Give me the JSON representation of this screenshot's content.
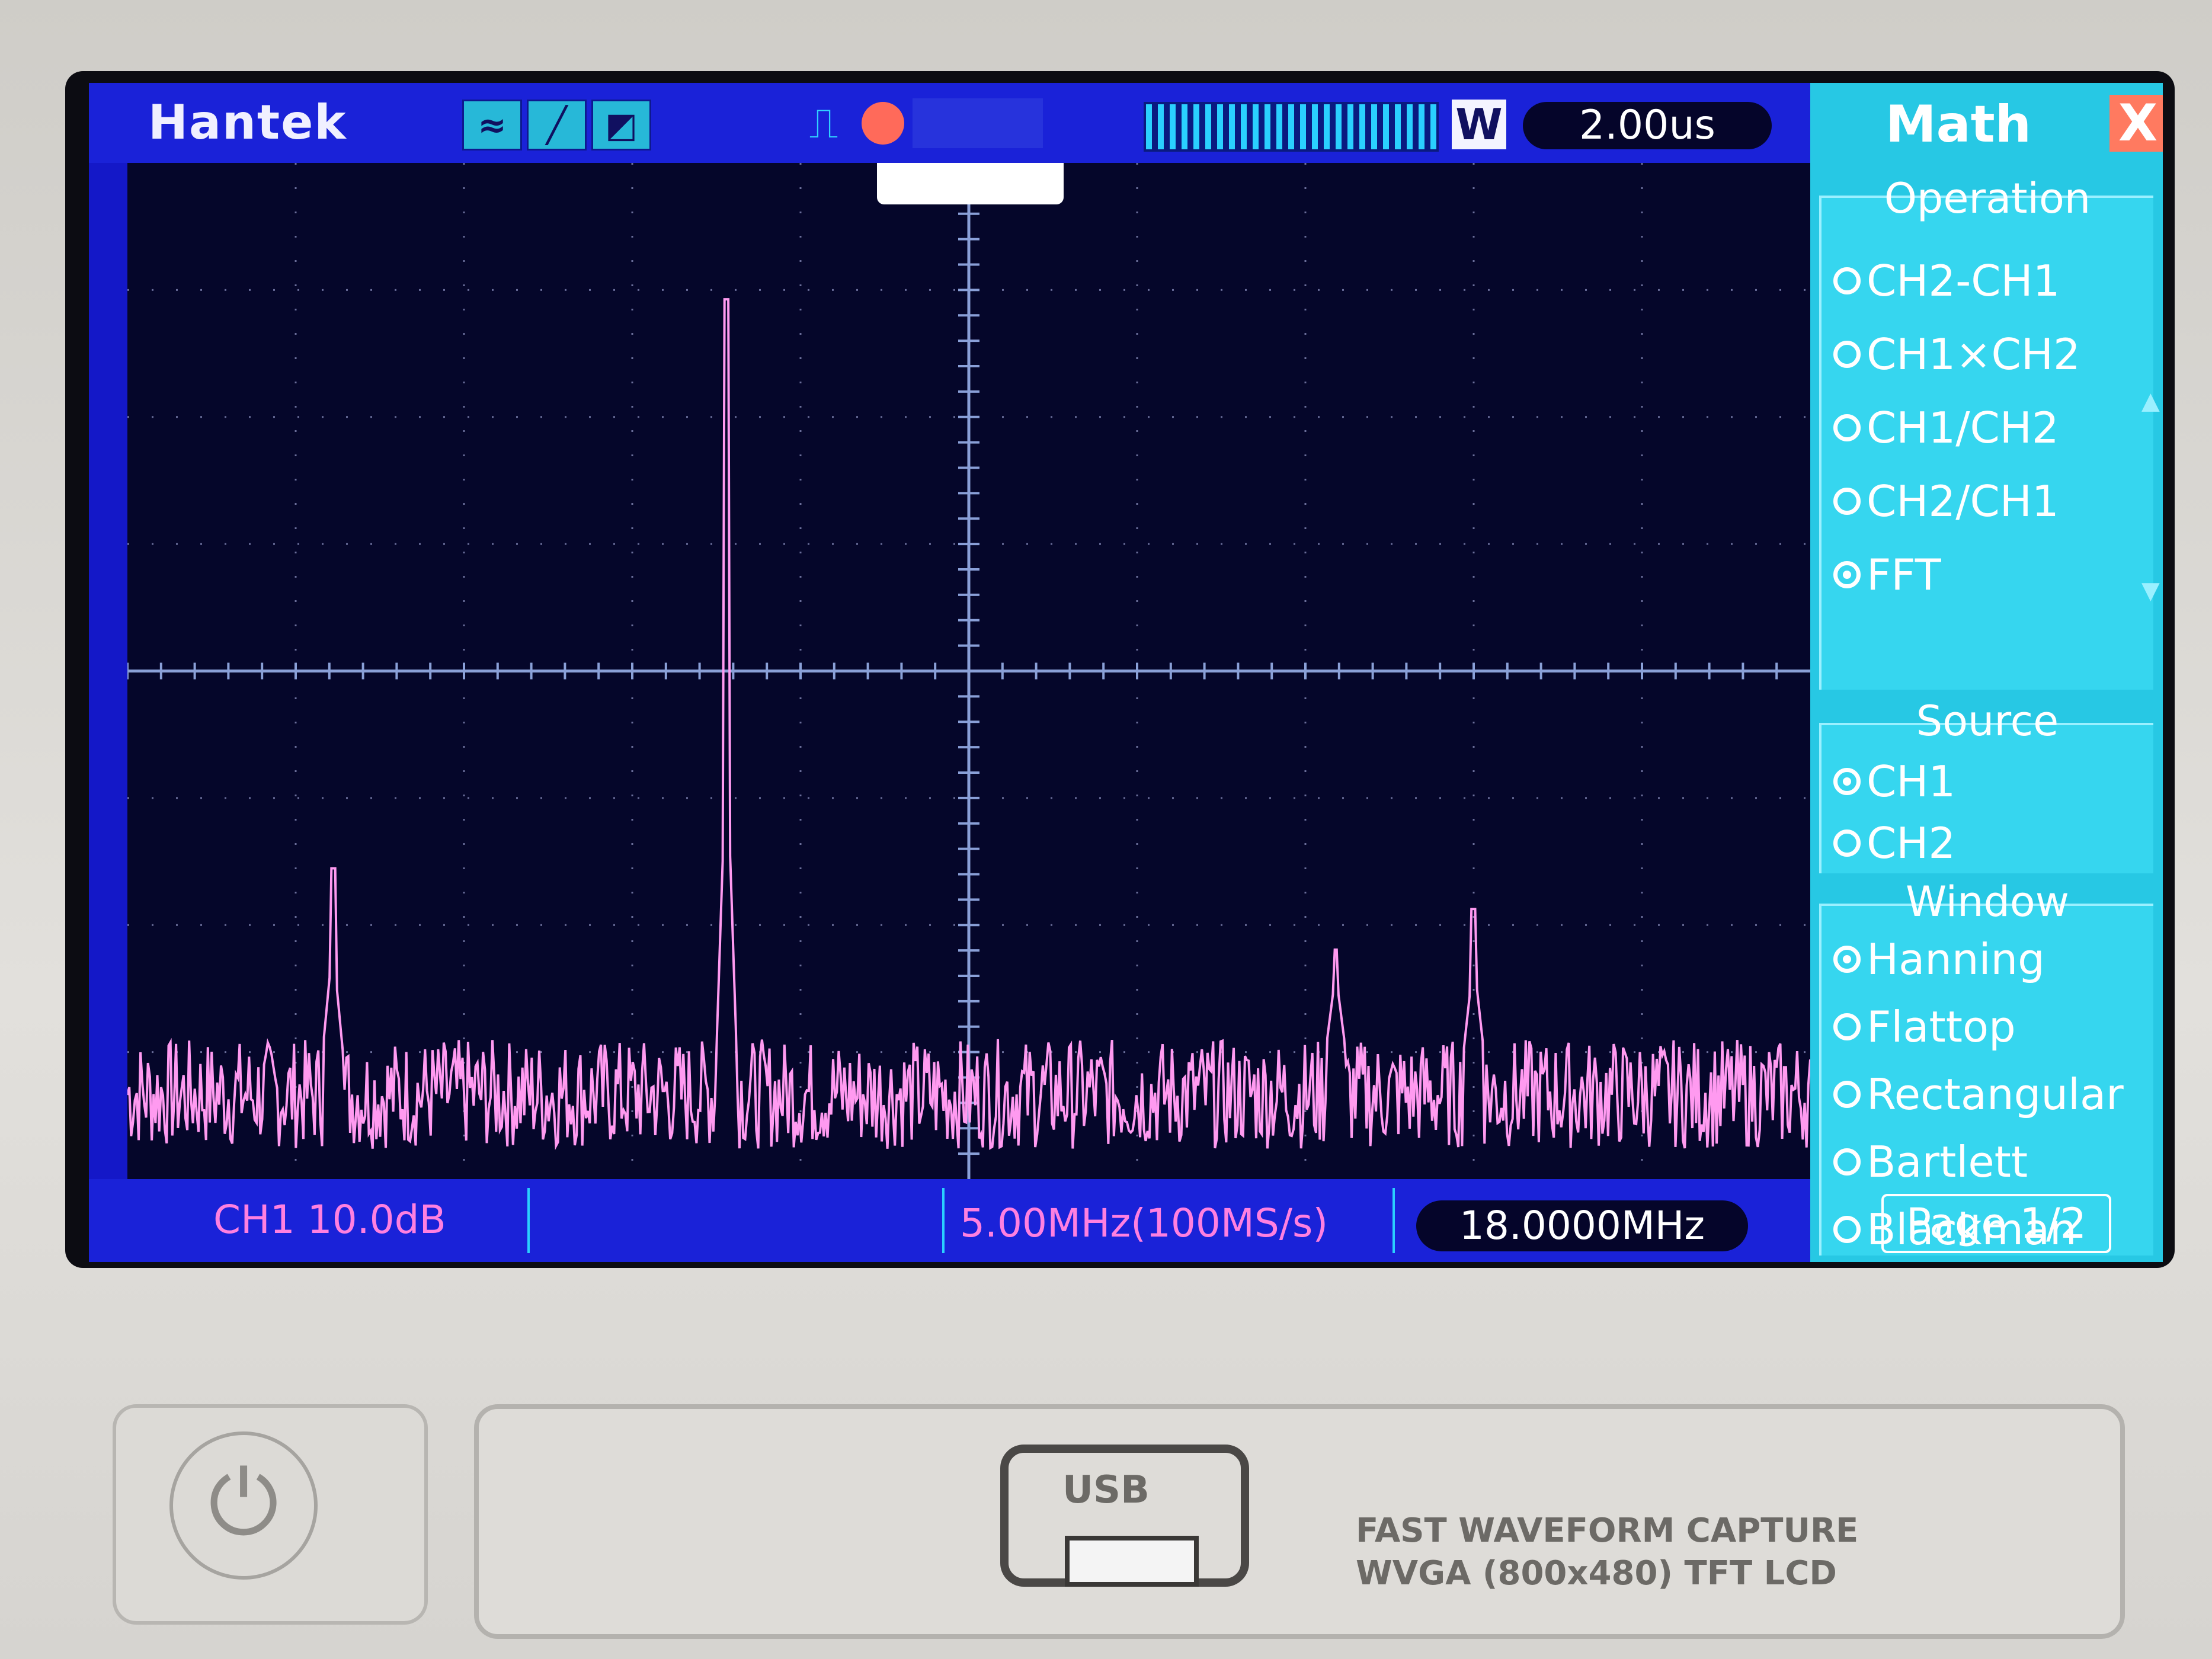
{
  "header": {
    "brand": "Hantek",
    "mode_icons": [
      "wave-mode-icon",
      "slope-mode-icon",
      "display-mode-icon"
    ],
    "mem_depth_label": "W",
    "timebase": "2.00us"
  },
  "status": {
    "channel_scale": "CH1 10.0dB",
    "fft_span": "5.00MHz(100MS/s)",
    "trigger_freq": "18.0000MHz"
  },
  "menu": {
    "title": "Math",
    "close_label": "X",
    "operation": {
      "title": "Operation",
      "options": [
        "CH2-CH1",
        "CH1×CH2",
        "CH1/CH2",
        "CH2/CH1",
        "FFT"
      ],
      "selected": "FFT"
    },
    "source": {
      "title": "Source",
      "options": [
        "CH1",
        "CH2"
      ],
      "selected": "CH1"
    },
    "window": {
      "title": "Window",
      "options": [
        "Hanning",
        "Flattop",
        "Rectangular",
        "Bartlett",
        "Blackman"
      ],
      "selected": "Hanning"
    },
    "page_label": "Page 1/2"
  },
  "panel": {
    "usb_label": "USB",
    "tagline_line1": "FAST WAVEFORM CAPTURE",
    "tagline_line2": "WVGA (800x480) TFT LCD"
  },
  "colors": {
    "screen_bg": "#1418c8",
    "plot_bg": "#05062a",
    "trace": "#ff9af0",
    "menu_bg": "#27c8e4",
    "accent_cyan": "#2ad0ff"
  },
  "trace": {
    "noise_floor_fraction": 0.12,
    "peaks": [
      {
        "position_fraction": 0.356,
        "level_fraction": 0.86
      },
      {
        "position_fraction": 0.122,
        "level_fraction": 0.3
      },
      {
        "position_fraction": 0.718,
        "level_fraction": 0.22
      },
      {
        "position_fraction": 0.8,
        "level_fraction": 0.26
      }
    ]
  }
}
